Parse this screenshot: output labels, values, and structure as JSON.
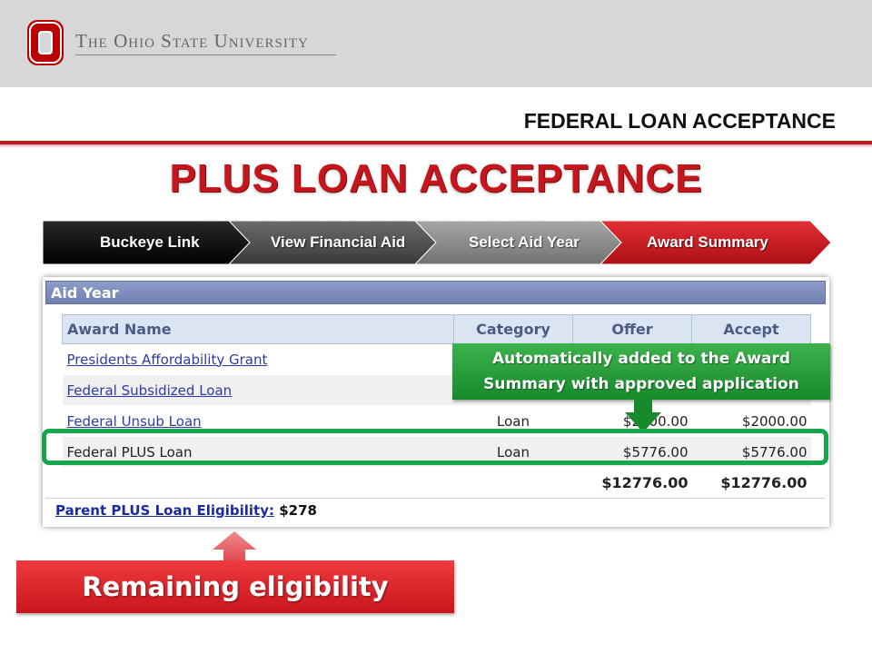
{
  "header": {
    "university": "The Ohio State University",
    "section_title": "FEDERAL LOAN ACCEPTANCE",
    "slide_title": "PLUS LOAN ACCEPTANCE"
  },
  "breadcrumbs": [
    "Buckeye Link",
    "View Financial Aid",
    "Select Aid Year",
    "Award Summary"
  ],
  "aid_panel": {
    "title": "Aid Year",
    "columns": [
      "Award Name",
      "Category",
      "Offer",
      "Accept"
    ],
    "rows": [
      {
        "name": "Presidents Affordability Grant",
        "category": "",
        "offer": "",
        "accept": ""
      },
      {
        "name": "Federal Subsidized Loan",
        "category": "",
        "offer": "",
        "accept": ""
      },
      {
        "name": "Federal Unsub Loan",
        "category": "Loan",
        "offer": "$2000.00",
        "accept": "$2000.00"
      },
      {
        "name": "Federal PLUS Loan",
        "category": "Loan",
        "offer": "$5776.00",
        "accept": "$5776.00"
      }
    ],
    "totals": {
      "offer": "$12776.00",
      "accept": "$12776.00"
    },
    "eligibility_label": "Parent PLUS Loan Eligibility:",
    "eligibility_value": "$278"
  },
  "callouts": {
    "auto_added_line1": "Automatically added to the Award",
    "auto_added_line2": "Summary with approved application",
    "remaining": "Remaining eligibility"
  },
  "colors": {
    "osu_scarlet": "#bb0000",
    "highlight_green": "#18a64a",
    "header_gray": "#d7d7d7"
  }
}
